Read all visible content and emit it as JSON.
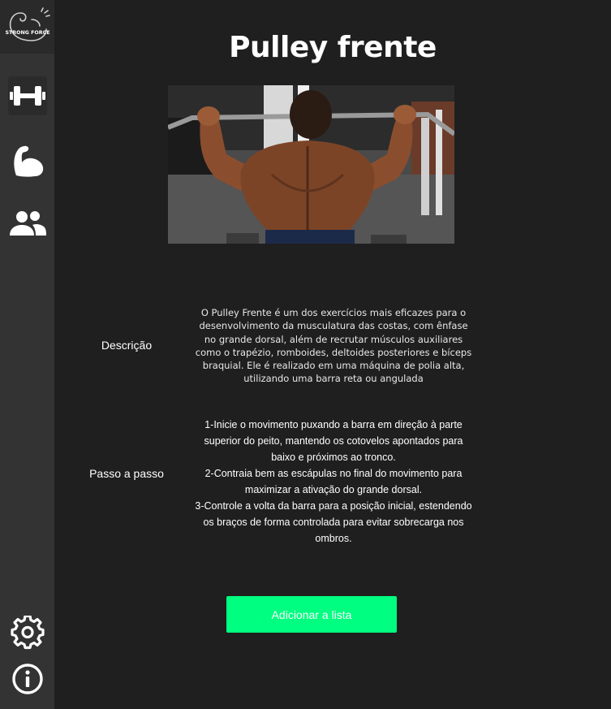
{
  "sidebar": {
    "logo_text": "STRONG FORCE",
    "items": [
      {
        "icon": "dumbbell-icon"
      },
      {
        "icon": "flexed-bicep-icon"
      },
      {
        "icon": "users-icon"
      }
    ],
    "bottom_items": [
      {
        "icon": "gear-icon"
      },
      {
        "icon": "info-icon"
      }
    ]
  },
  "exercise": {
    "title": "Pulley frente",
    "image_alt": "Pulley frente",
    "description_label": "Descrição",
    "description": "O Pulley Frente é um dos exercícios mais eficazes para o desenvolvimento da musculatura das costas, com ênfase no grande dorsal, além de recrutar músculos auxiliares como o trapézio, romboides, deltoides posteriores e bíceps braquial. Ele é realizado em uma máquina de polia alta, utilizando uma barra reta ou angulada",
    "steps_label": "Passo a passo",
    "steps": [
      "1-Inicie o movimento puxando a barra em direção à parte superior do peito, mantendo os cotovelos apontados para baixo e próximos ao tronco.",
      "2-Contraia bem as escápulas no final do movimento para maximizar a ativação do grande dorsal.",
      "3-Controle a volta da barra para a posição inicial, estendendo os braços de forma controlada para evitar sobrecarga nos ombros."
    ]
  },
  "actions": {
    "add_label": "Adicionar a lista"
  },
  "colors": {
    "background": "#1f1f1f",
    "sidebar": "#333333",
    "accent": "#00ff80",
    "text": "#ffffff"
  }
}
